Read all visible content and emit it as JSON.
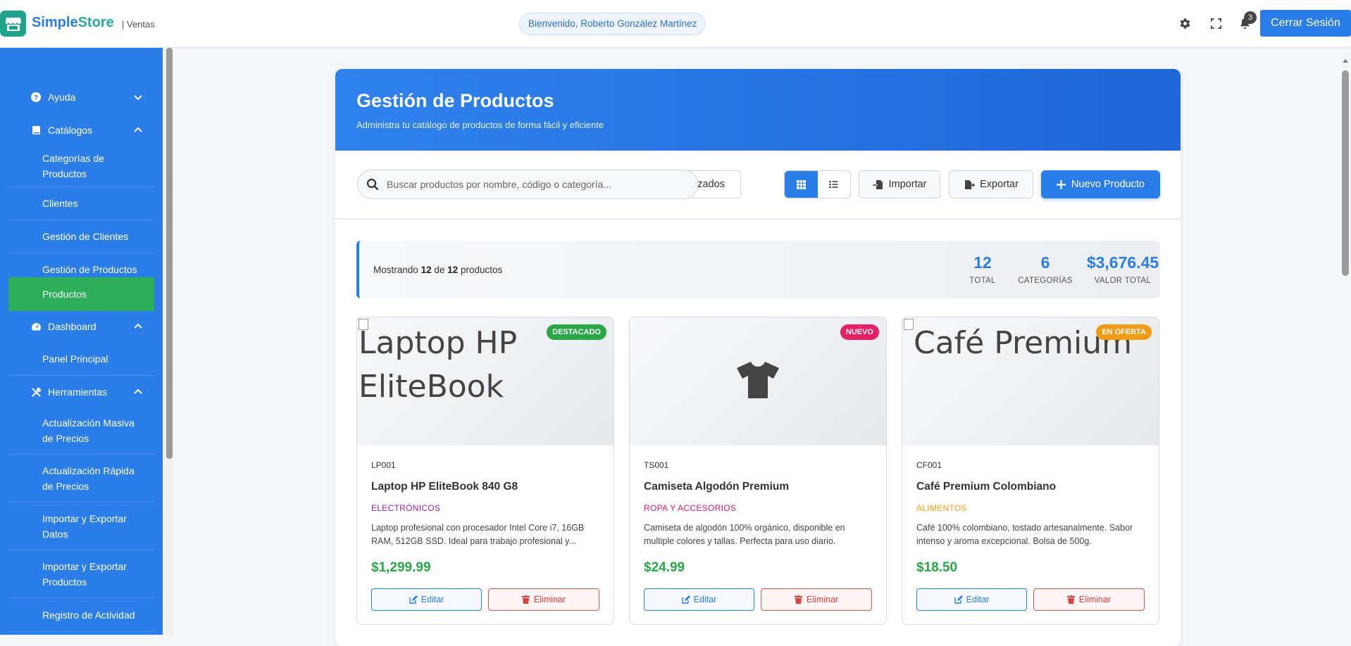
{
  "colors": {
    "primary": "#2b7de9",
    "active": "#2cae5a",
    "price": "#28a745"
  },
  "header": {
    "brand_a": "Simple",
    "brand_b": "Store",
    "brand_sep": "| Ventas",
    "welcome": "Bienvenido, Roberto González Martínez",
    "notifications_count": "3",
    "logout_label": "Cerrar Sesión",
    "icons": [
      "gear-icon",
      "fullscreen-icon",
      "bell-icon"
    ]
  },
  "sidebar": {
    "groups": {
      "ayuda": "Ayuda",
      "catalogos": "Catálogos",
      "dashboard": "Dashboard",
      "herramientas": "Herramientas"
    },
    "items": {
      "categorias": "Categorías de Productos",
      "clientes": "Clientes",
      "gestion_clientes": "Gestión de Clientes",
      "gestion_productos": "Gestión de Productos",
      "productos": "Productos",
      "panel": "Panel Principal",
      "act_masiva": "Actualización Masiva de Precios",
      "act_rapida": "Actualización Rápida de Precios",
      "imp_datos": "Importar y Exportar Datos",
      "imp_productos": "Importar y Exportar Productos",
      "registro": "Registro de Actividad"
    },
    "active_item": "Productos"
  },
  "page": {
    "title": "Gestión de Productos",
    "subtitle": "Administra tu catálogo de productos de forma fácil y eficiente"
  },
  "toolbar": {
    "search_placeholder": "Buscar productos por nombre, código o categoría...",
    "filters_label": "s Avanzados",
    "import_label": "Importar",
    "export_label": "Exportar",
    "new_label": "Nuevo Producto",
    "view_mode": "grid"
  },
  "stats": {
    "showing_prefix": "Mostrando",
    "shown": "12",
    "of": "de",
    "total_count": "12",
    "showing_suffix": "productos",
    "total_value": "12",
    "total_label": "TOTAL",
    "categories_value": "6",
    "categories_label": "CATEGORÍAS",
    "value_value": "$3,676.45",
    "value_label": "VALOR TOTAL"
  },
  "products": [
    {
      "image_alt": "Laptop HP EliteBook",
      "tag": "DESTACADO",
      "tag_color": "#28a745",
      "code": "LP001",
      "name": "Laptop HP EliteBook 840 G8",
      "category": "ELECTRÓNICOS",
      "category_color": "#8e24aa",
      "description": "Laptop profesional con procesador Intel Core i7, 16GB RAM, 512GB SSD. Ideal para trabajo profesional y...",
      "price": "$1,299.99",
      "edit_label": "Editar",
      "delete_label": "Eliminar"
    },
    {
      "image_alt": "",
      "tag": "NUEVO",
      "tag_color": "#e91e63",
      "code": "TS001",
      "name": "Camiseta Algodón Premium",
      "category": "ROPA Y ACCESORIOS",
      "category_color": "#d81b60",
      "description": "Camiseta de algodón 100% orgánico, disponible en multiple colores y tallas. Perfecta para uso diario.",
      "price": "$24.99",
      "edit_label": "Editar",
      "delete_label": "Eliminar"
    },
    {
      "image_alt": "Café Premium",
      "tag": "EN OFERTA",
      "tag_color": "#f39c12",
      "code": "CF001",
      "name": "Café Premium Colombiano",
      "category": "ALIMENTOS",
      "category_color": "#f39c12",
      "description": "Café 100% colombiano, tostado artesanalmente. Sabor intenso y aroma excepcional. Bolsa de 500g.",
      "price": "$18.50",
      "edit_label": "Editar",
      "delete_label": "Eliminar"
    }
  ]
}
